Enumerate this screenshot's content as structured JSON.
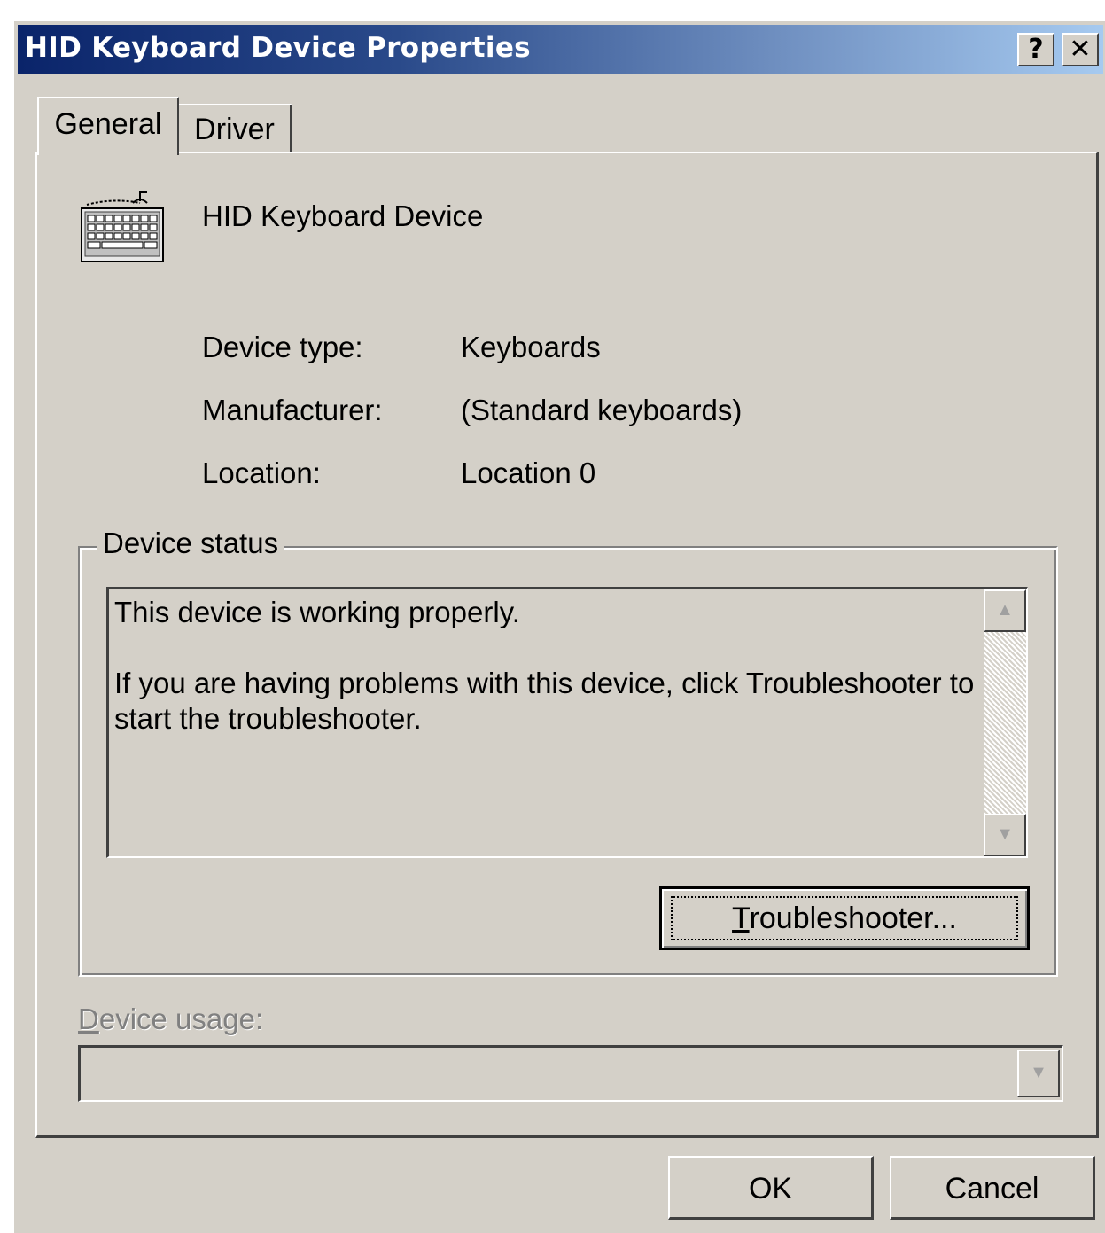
{
  "window": {
    "title": "HID Keyboard Device Properties",
    "help_glyph": "?",
    "close_glyph": "✕"
  },
  "tabs": [
    {
      "label": "General",
      "selected": true
    },
    {
      "label": "Driver",
      "selected": false
    }
  ],
  "device": {
    "name": "HID Keyboard Device",
    "icon": "keyboard-icon"
  },
  "properties": [
    {
      "label": "Device type:",
      "value": "Keyboards"
    },
    {
      "label": "Manufacturer:",
      "value": "(Standard keyboards)"
    },
    {
      "label": "Location:",
      "value": "Location 0"
    }
  ],
  "device_status": {
    "group_label": "Device status",
    "line1": "This device is working properly.",
    "line2": "If you are having problems with this device, click Troubleshooter to start the troubleshooter.",
    "troubleshooter_button": {
      "mnemonic": "T",
      "rest": "roubleshooter..."
    }
  },
  "device_usage": {
    "label_mnemonic": "D",
    "label_rest": "evice usage:",
    "value": "",
    "enabled": false
  },
  "buttons": {
    "ok": "OK",
    "cancel": "Cancel"
  }
}
